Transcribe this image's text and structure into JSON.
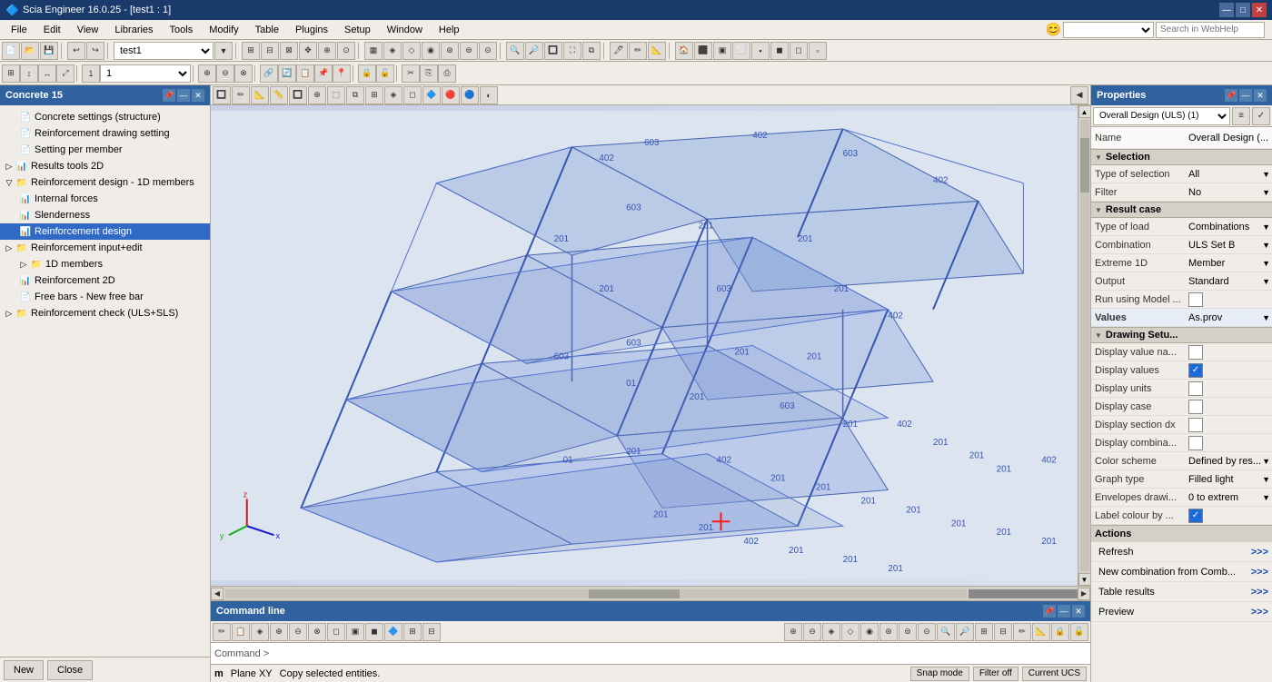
{
  "titlebar": {
    "title": "Scia Engineer 16.0.25 - [test1 : 1]",
    "minimize": "—",
    "maximize": "□",
    "close": "✕",
    "app_minimize": "—",
    "app_maximize": "□",
    "app_close": "✕"
  },
  "menu": {
    "items": [
      "File",
      "Edit",
      "View",
      "Libraries",
      "Tools",
      "Modify",
      "Table",
      "Plugins",
      "Setup",
      "Window",
      "Help"
    ]
  },
  "toolbar1": {
    "dropdown_value": "test1"
  },
  "left_panel": {
    "title": "Concrete 15",
    "items": [
      {
        "label": "Concrete settings (structure)",
        "level": 1,
        "icon": "📄",
        "expandable": false
      },
      {
        "label": "Reinforcement drawing setting",
        "level": 1,
        "icon": "📄",
        "expandable": false
      },
      {
        "label": "Setting per member",
        "level": 1,
        "icon": "📄",
        "expandable": false
      },
      {
        "label": "Results tools 2D",
        "level": 0,
        "icon": "▶",
        "expandable": true
      },
      {
        "label": "Reinforcement design - 1D members",
        "level": 0,
        "icon": "▼",
        "expandable": true,
        "expanded": true
      },
      {
        "label": "Internal forces",
        "level": 1,
        "icon": "📊",
        "expandable": false
      },
      {
        "label": "Slenderness",
        "level": 1,
        "icon": "📊",
        "expandable": false
      },
      {
        "label": "Reinforcement design",
        "level": 1,
        "icon": "📊",
        "expandable": false,
        "selected": true
      },
      {
        "label": "Reinforcement input+edit",
        "level": 0,
        "icon": "▶",
        "expandable": true
      },
      {
        "label": "1D members",
        "level": 1,
        "icon": "▶",
        "expandable": true
      },
      {
        "label": "Reinforcement 2D",
        "level": 1,
        "icon": "📊",
        "expandable": false
      },
      {
        "label": "Free bars - New free bar",
        "level": 1,
        "icon": "📄",
        "expandable": false
      },
      {
        "label": "Reinforcement check (ULS+SLS)",
        "level": 0,
        "icon": "▶",
        "expandable": true
      }
    ],
    "btn_new": "New",
    "btn_close": "Close"
  },
  "properties": {
    "title": "Properties",
    "dropdown": "Overall Design (ULS) (1)",
    "name_label": "Name",
    "name_value": "Overall Design (...",
    "section_selection": "Selection",
    "type_of_selection_label": "Type of selection",
    "type_of_selection_value": "All",
    "filter_label": "Filter",
    "filter_value": "No",
    "section_result_case": "Result case",
    "type_of_load_label": "Type of load",
    "type_of_load_value": "Combinations",
    "combination_label": "Combination",
    "combination_value": "ULS Set B",
    "extreme_1d_label": "Extreme 1D",
    "extreme_1d_value": "Member",
    "output_label": "Output",
    "output_value": "Standard",
    "run_using_model_label": "Run using Model ...",
    "values_label": "Values",
    "values_value": "As.prov",
    "section_drawing": "Drawing Setu...",
    "display_value_na_label": "Display value na...",
    "display_values_label": "Display values",
    "display_units_label": "Display units",
    "display_case_label": "Display case",
    "display_section_dx_label": "Display section dx",
    "display_combina_label": "Display combina...",
    "color_scheme_label": "Color scheme",
    "color_scheme_value": "Defined by res...",
    "graph_type_label": "Graph type",
    "graph_type_value": "Filled light",
    "envelopes_drawi_label": "Envelopes drawi...",
    "envelopes_drawi_value": "0 to extrem",
    "label_colour_by_label": "Label colour by ...",
    "section_actions": "Actions",
    "refresh_label": "Refresh",
    "refresh_btn": ">>>",
    "new_combination_label": "New combination from Comb...",
    "new_combination_btn": ">>>",
    "table_results_label": "Table results",
    "table_results_btn": ">>>",
    "preview_label": "Preview",
    "preview_btn": ">>>"
  },
  "command_line": {
    "title": "Command line",
    "prompt": "Command >"
  },
  "status_bar": {
    "mode": "m",
    "plane": "Plane XY",
    "action": "Copy selected entities.",
    "snap_mode": "Snap mode",
    "filter_off": "Filter off",
    "current_ucs": "Current UCS"
  },
  "viewport": {
    "model_numbers": [
      "603",
      "402",
      "201",
      "201",
      "603",
      "402",
      "201",
      "402",
      "603",
      "201",
      "603",
      "603",
      "201",
      "402",
      "201",
      "201",
      "603",
      "201",
      "402",
      "201",
      "201",
      "201",
      "201",
      "201"
    ]
  },
  "webhelp": {
    "placeholder": "Search in WebHelp"
  }
}
